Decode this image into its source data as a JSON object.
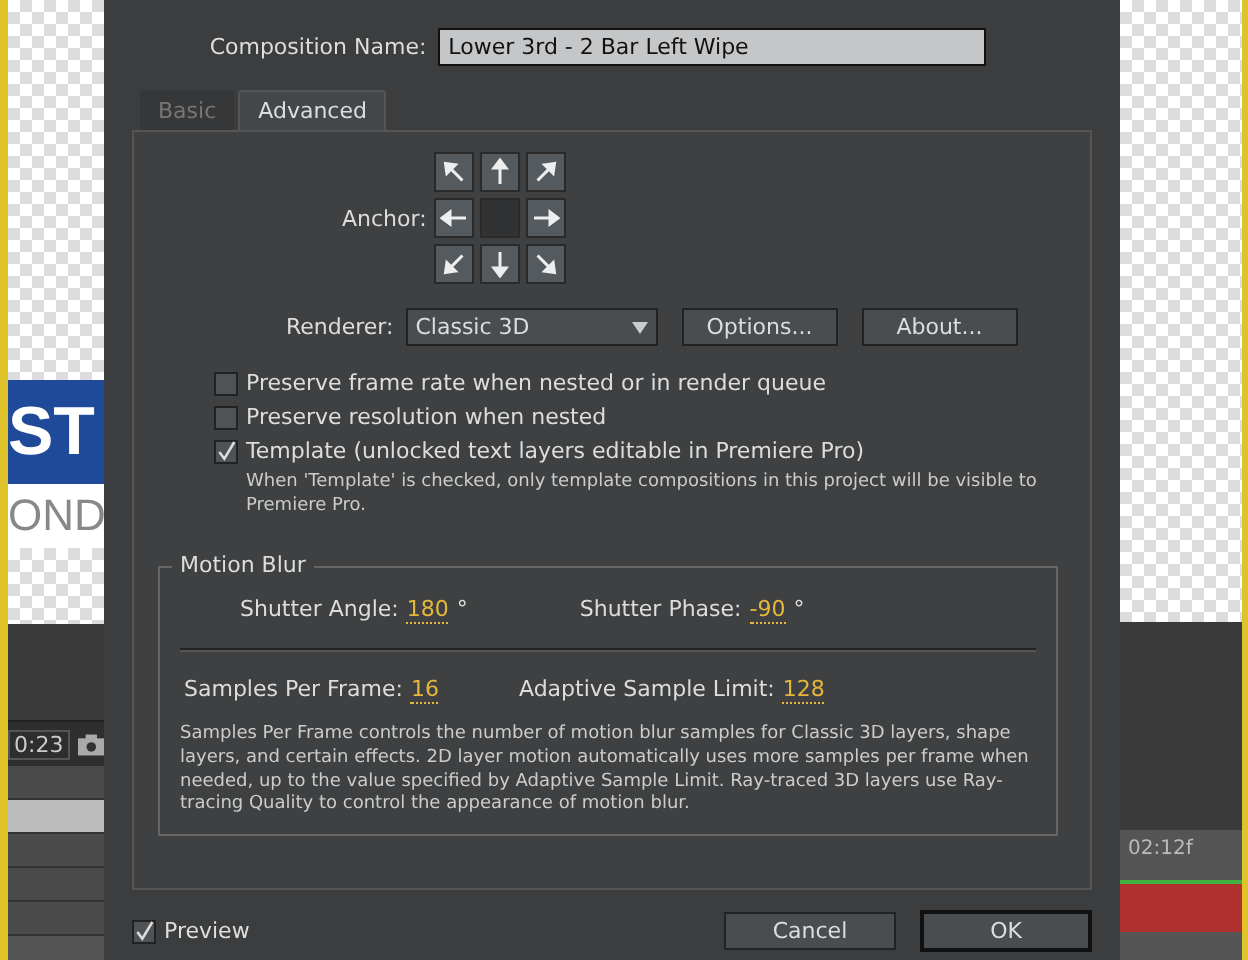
{
  "background": {
    "left": {
      "title_fragment": "ST",
      "subtitle_fragment": "OND",
      "timecode": "0:23"
    },
    "right": {
      "timecode": "02:12f"
    }
  },
  "composition_name": {
    "label": "Composition Name:",
    "value": "Lower 3rd - 2 Bar Left Wipe"
  },
  "tabs": [
    {
      "label": "Basic",
      "selected": false
    },
    {
      "label": "Advanced",
      "selected": true
    }
  ],
  "anchor": {
    "label": "Anchor:"
  },
  "renderer": {
    "label": "Renderer:",
    "value": "Classic 3D",
    "buttons": [
      "Options...",
      "About..."
    ]
  },
  "options": [
    {
      "label": "Preserve frame rate when nested or in render queue",
      "checked": false
    },
    {
      "label": "Preserve resolution when nested",
      "checked": false
    },
    {
      "label": "Template (unlocked text layers editable in Premiere Pro)",
      "checked": true
    }
  ],
  "template_note": "When 'Template' is checked, only template compositions in this project will be visible to Premiere Pro.",
  "motion_blur": {
    "title": "Motion Blur",
    "shutter_angle": {
      "label": "Shutter Angle:",
      "value": "180",
      "unit": "°"
    },
    "shutter_phase": {
      "label": "Shutter Phase:",
      "value": "-90",
      "unit": "°"
    },
    "samples_per_frame": {
      "label": "Samples Per Frame:",
      "value": "16"
    },
    "adaptive_sample_limit": {
      "label": "Adaptive Sample Limit:",
      "value": "128"
    },
    "description": "Samples Per Frame controls the number of motion blur samples for Classic 3D layers, shape layers, and certain effects. 2D layer motion automatically uses more samples per frame when needed, up to the value specified by Adaptive Sample Limit. Ray-traced 3D layers use Ray-tracing Quality to control the appearance of motion blur."
  },
  "preview": {
    "label": "Preview",
    "checked": true
  },
  "buttons": [
    "Cancel",
    "OK"
  ]
}
